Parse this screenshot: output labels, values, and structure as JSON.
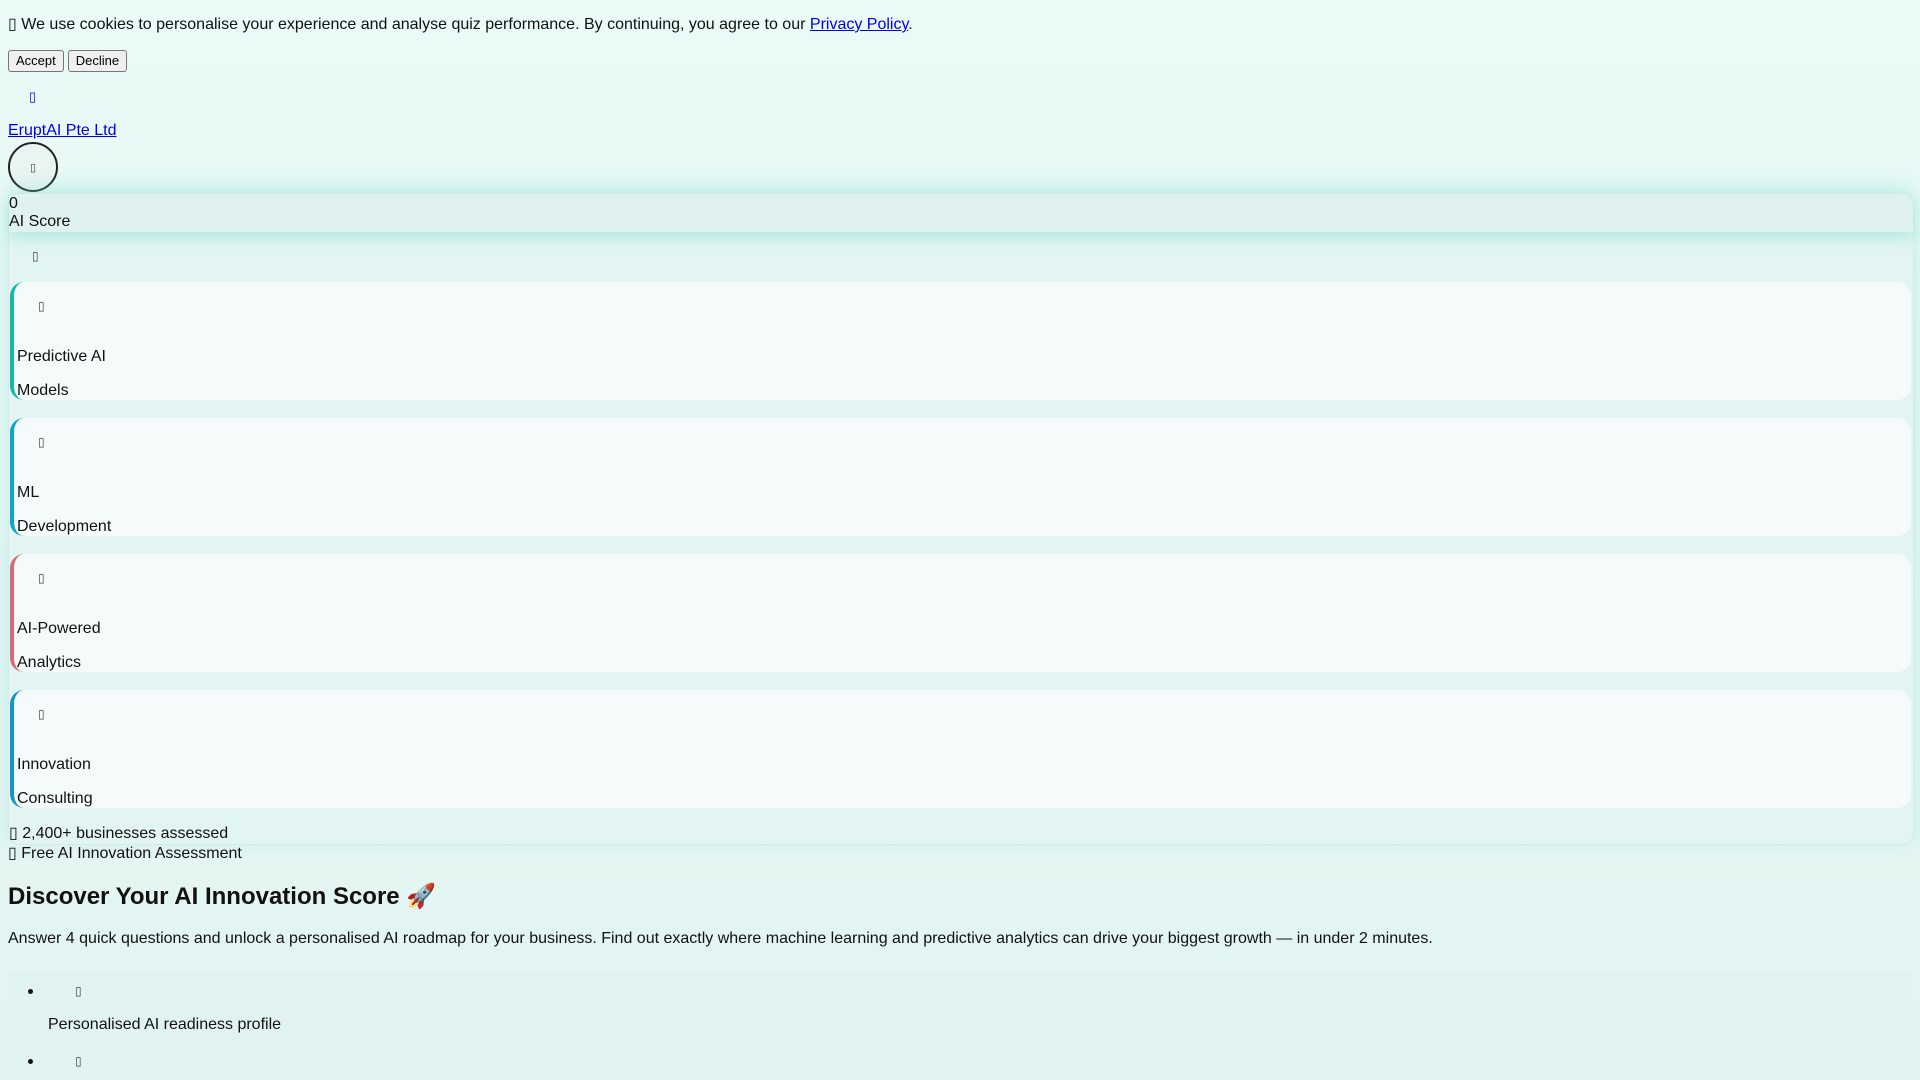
{
  "cookie_banner": {
    "icon": "cookie-icon",
    "message": "We use cookies to personalise your experience and analyse quiz performance. By continuing, you agree to our",
    "policy_link": "Privacy Policy",
    "period": ".",
    "accept_label": "Accept",
    "decline_label": "Decline"
  },
  "header": {
    "icon": "logo-icon",
    "brand": "EruptAI Pte Ltd",
    "menu_icon": "menu-icon"
  },
  "score": {
    "value": "0",
    "label": "AI Score",
    "icon": "gauge-icon"
  },
  "services": [
    {
      "icon": "chart-icon",
      "line1": "Predictive AI",
      "line2": "Models",
      "accent": "#14b8a6"
    },
    {
      "icon": "brain-icon",
      "line1": "ML",
      "line2": "Development",
      "accent": "#0ea5c9"
    },
    {
      "icon": "analytics-icon",
      "line1": "AI-Powered",
      "line2": "Analytics",
      "accent": "#d46b78"
    },
    {
      "icon": "lightbulb-icon",
      "line1": "Innovation",
      "line2": "Consulting",
      "accent": "#1595c4"
    }
  ],
  "stats": {
    "icon": "users-icon",
    "assessed": "2,400+ businesses assessed"
  },
  "hero": {
    "badge_icon": "sparkle-icon",
    "badge": "Free AI Innovation Assessment",
    "title": "Discover Your AI Innovation Score 🚀",
    "intro": "Answer 4 quick questions and unlock a personalised AI roadmap for your business. Find out exactly where machine learning and predictive analytics can drive your biggest growth — in under 2 minutes."
  },
  "benefits": [
    {
      "icon": "profile-icon",
      "text": "Personalised AI readiness profile"
    },
    {
      "icon": "check-icon",
      "text": ""
    }
  ]
}
